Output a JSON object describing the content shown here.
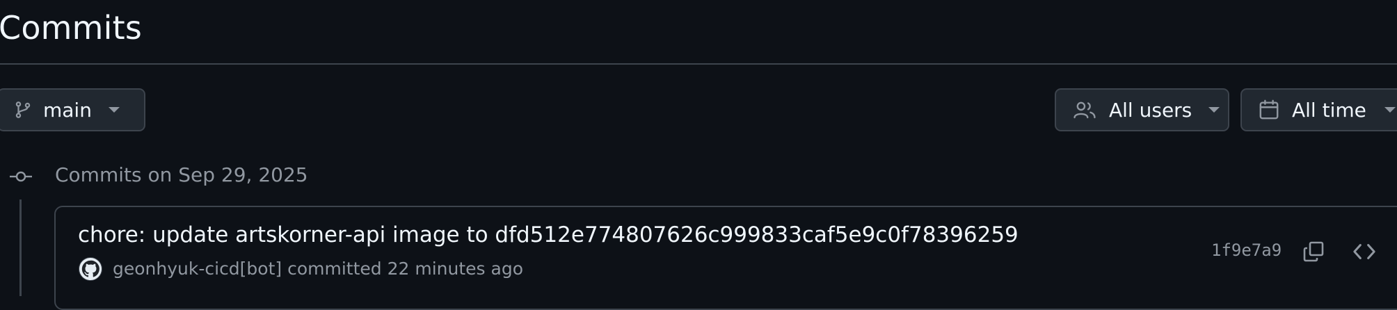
{
  "page": {
    "title": "Commits"
  },
  "toolbar": {
    "branch_label": "main",
    "users_label": "All users",
    "time_label": "All time"
  },
  "commit_groups": [
    {
      "heading": "Commits on Sep 29, 2025",
      "commits": [
        {
          "message": "chore: update artskorner-api image to dfd512e774807626c999833caf5e9c0f78396259",
          "author": "geonhyuk-cicd[bot]",
          "action": "committed",
          "time_ago": "22 minutes ago",
          "sha": "1f9e7a9"
        }
      ]
    }
  ],
  "icons": {
    "branch": "git-branch-icon",
    "users": "people-icon",
    "time": "calendar-icon",
    "group": "git-commit-icon",
    "copy": "copy-icon",
    "browse": "code-icon"
  },
  "colors": {
    "background": "#0d1117",
    "border": "#3d444d",
    "text_primary": "#f0f6fc",
    "text_muted": "#9198a1",
    "button_bg": "#212830"
  }
}
